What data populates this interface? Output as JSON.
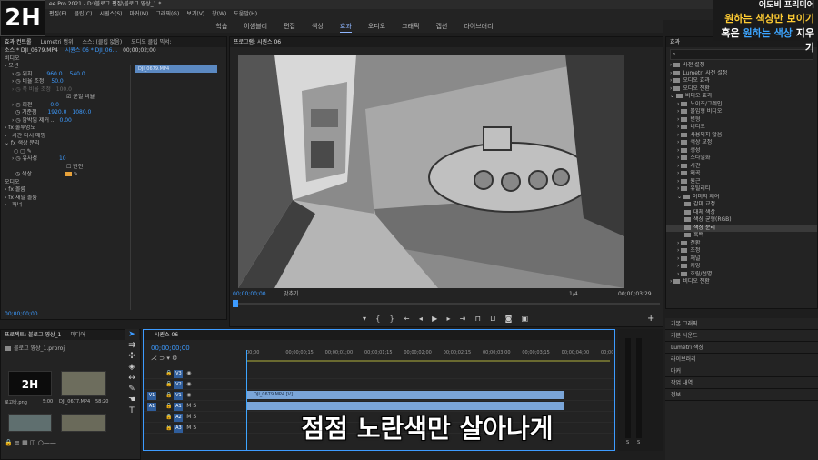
{
  "app": {
    "title": "ee Pro 2021 - D:\\블로그 편집\\블로그 영상_1 *",
    "logo_text": "2H",
    "menu": [
      "편집(E)",
      "클립(C)",
      "시퀀스(S)",
      "마커(M)",
      "그래픽(G)",
      "보기(V)",
      "창(W)",
      "도움말(H)"
    ]
  },
  "workspaces": {
    "items": [
      "학습",
      "어셈블리",
      "편집",
      "색상",
      "효과",
      "오디오",
      "그래픽",
      "캡션",
      "라이브러리"
    ],
    "active_index": 4
  },
  "banner": {
    "line1": "어도비 프리미어",
    "line2": "원하는 색상만 보이기",
    "line3_prefix": "혹은 ",
    "line3_highlight": "원하는 색상",
    "line3_suffix": " 지우기"
  },
  "effect_controls": {
    "tabs": [
      "효과 컨트롤",
      "Lumetri 범위",
      "소스: (클립 없음)",
      "오디오 클립 믹서:"
    ],
    "source_label": "소스 * DJI_0679.MP4",
    "sequence_label": "시퀀스 06 * DJI_06...",
    "clip_name": "DJI_0679.MP4",
    "section_video": "비디오",
    "motion": "모션",
    "position_label": "위치",
    "position_x": "960.0",
    "position_y": "540.0",
    "scale_label": "비율 조정",
    "scale_value": "50.0",
    "scale_width_label": "폭 비율 조정",
    "scale_width_value": "100.0",
    "uniform_scale_label": "균일 비율",
    "rotation_label": "회전",
    "rotation_value": "0.0",
    "anchor_label": "기준점",
    "anchor_x": "1920.0",
    "anchor_y": "1080.0",
    "flicker_label": "깜박임 제거 ...",
    "flicker_value": "0.00",
    "opacity_label": "불투명도",
    "remap_label": "시간 다시 매핑",
    "color_pass_label": "색상 분리",
    "similarity_label": "유사성",
    "similarity_value": "10",
    "invert_label": "반전",
    "color_label": "색상",
    "section_audio": "오디오",
    "volume_label": "볼륨",
    "channel_volume_label": "채널 볼륨",
    "panner_label": "패너",
    "timecode": "00;00;00;00",
    "clip_timecode": "00;00;02;00"
  },
  "program": {
    "tab": "프로그램: 시퀀스 06",
    "timecode": "00;00;00;00",
    "fit_label": "맞추기",
    "quality": "1/4",
    "duration": "00;00;03;29"
  },
  "effects_panel": {
    "tab": "효과",
    "items": [
      {
        "label": "사전 설정",
        "level": 0,
        "open": false
      },
      {
        "label": "Lumetri 사전 설정",
        "level": 0,
        "open": false
      },
      {
        "label": "오디오 효과",
        "level": 0,
        "open": false
      },
      {
        "label": "오디오 전환",
        "level": 0,
        "open": false
      },
      {
        "label": "비디오 효과",
        "level": 0,
        "open": true
      },
      {
        "label": "노이즈/그레인",
        "level": 1,
        "open": false
      },
      {
        "label": "몰입형 비디오",
        "level": 1,
        "open": false
      },
      {
        "label": "변형",
        "level": 1,
        "open": false
      },
      {
        "label": "비디오",
        "level": 1,
        "open": false
      },
      {
        "label": "사용되지 않음",
        "level": 1,
        "open": false
      },
      {
        "label": "색상 교정",
        "level": 1,
        "open": false
      },
      {
        "label": "생성",
        "level": 1,
        "open": false
      },
      {
        "label": "스타일화",
        "level": 1,
        "open": false
      },
      {
        "label": "시간",
        "level": 1,
        "open": false
      },
      {
        "label": "왜곡",
        "level": 1,
        "open": false
      },
      {
        "label": "원근",
        "level": 1,
        "open": false
      },
      {
        "label": "유틸리티",
        "level": 1,
        "open": false
      },
      {
        "label": "이미지 제어",
        "level": 1,
        "open": true
      },
      {
        "label": "감마 교정",
        "level": 2,
        "open": false
      },
      {
        "label": "대체 색상",
        "level": 2,
        "open": false
      },
      {
        "label": "색상 균형(RGB)",
        "level": 2,
        "open": false
      },
      {
        "label": "색상 분리",
        "level": 2,
        "open": false,
        "selected": true
      },
      {
        "label": "흑백",
        "level": 2,
        "open": false
      },
      {
        "label": "전환",
        "level": 1,
        "open": false
      },
      {
        "label": "조정",
        "level": 1,
        "open": false
      },
      {
        "label": "채널",
        "level": 1,
        "open": false
      },
      {
        "label": "키잉",
        "level": 1,
        "open": false
      },
      {
        "label": "흐림/선명",
        "level": 1,
        "open": false
      },
      {
        "label": "비디오 전환",
        "level": 0,
        "open": false
      }
    ],
    "lower_panels": [
      "기본 그래픽",
      "기본 사운드",
      "Lumetri 색상",
      "라이브러리",
      "마커",
      "작업 내역",
      "정보"
    ]
  },
  "project": {
    "tabs": [
      "프로젝트: 블로그 영상_1",
      "미디어"
    ],
    "file": "블로그 영상_1.prproj",
    "thumbs": [
      {
        "name": "로고바.png",
        "duration": "5:00"
      },
      {
        "name": "DJI_0677.MP4",
        "duration": "58:20"
      }
    ]
  },
  "timeline": {
    "tab": "시퀀스 06",
    "timecode": "00;00;00;00",
    "ruler": [
      "00;00",
      "00;00;00;15",
      "00;00;01;00",
      "00;00;01;15",
      "00;00;02;00",
      "00;00;02;15",
      "00;00;03;00",
      "00;00;03;15",
      "00;00;04;00",
      "00;00"
    ],
    "tracks": [
      "V3",
      "V2",
      "V1",
      "A1",
      "A2",
      "A3"
    ],
    "clip_label": "DJI_0679.MP4 [V]",
    "subtitle": "점점 노란색만 살아나게"
  },
  "meter": {
    "labels": [
      "S",
      "S"
    ]
  }
}
